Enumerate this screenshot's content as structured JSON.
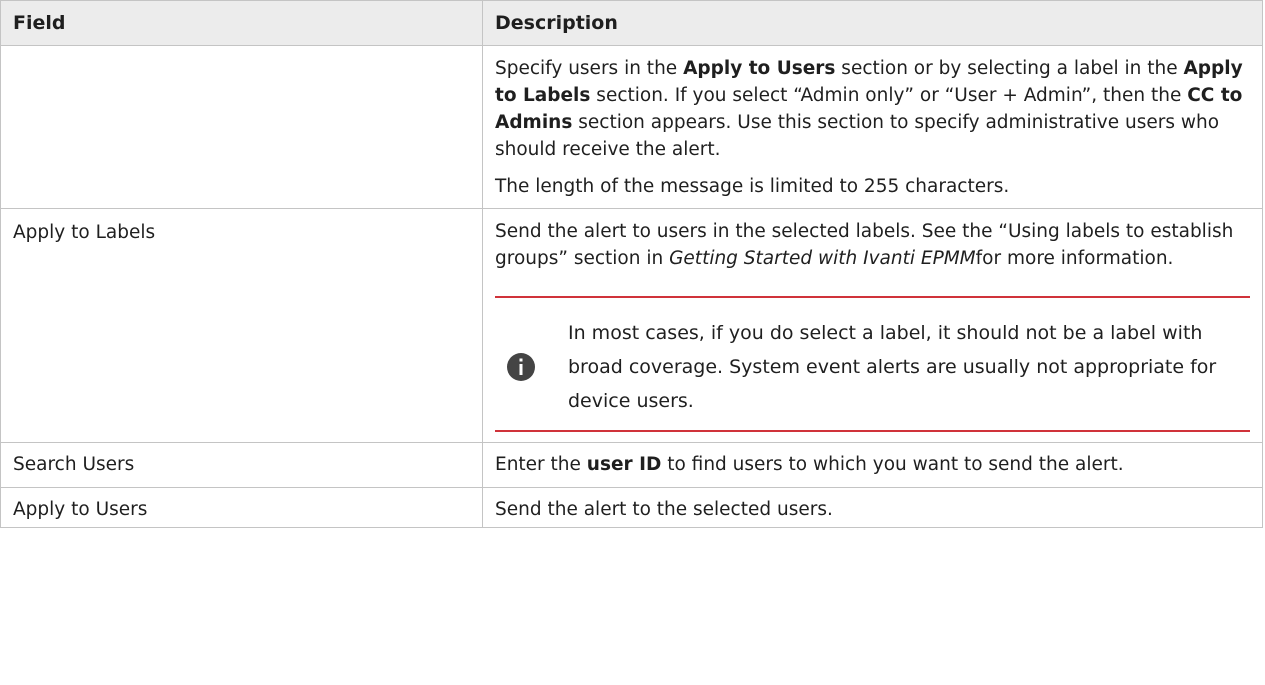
{
  "table": {
    "headers": {
      "field": "Field",
      "description": "Description"
    },
    "rows": [
      {
        "field": "",
        "description": {
          "p1": {
            "t1": "Specify users in the ",
            "b1": "Apply to Users",
            "t2": " section or by selecting a label in the ",
            "b2": "Apply to Labels",
            "t3": " section. If you select “Admin only” or “User + Admin”, then the ",
            "b3": "CC to Admins",
            "t4": " section appears. Use this section to specify administrative users who should receive the alert."
          },
          "p2": "The length of the message is limited to 255 characters."
        }
      },
      {
        "field": "Apply to Labels",
        "description": {
          "t1": "Send the alert to users in the selected labels. See the “Using labels to establish groups” section in ",
          "i1": "Getting Started with Ivanti EPMM",
          "t2": "for more information.",
          "note": "In most cases, if you do select a label, it should not be a label with broad coverage. System event alerts are usually not appropriate for device users.",
          "note_icon": "info-icon"
        }
      },
      {
        "field": "Search Users",
        "description": {
          "t1": "Enter the ",
          "b1": "user ID",
          "t2": " to find users to which you want to send the alert."
        }
      },
      {
        "field": "Apply to Users",
        "description": "Send the alert to the selected users."
      }
    ]
  },
  "colors": {
    "header_bg": "#ececec",
    "border": "#c4c4c4",
    "note_rule": "#d0333a",
    "icon_bg": "#444444"
  }
}
